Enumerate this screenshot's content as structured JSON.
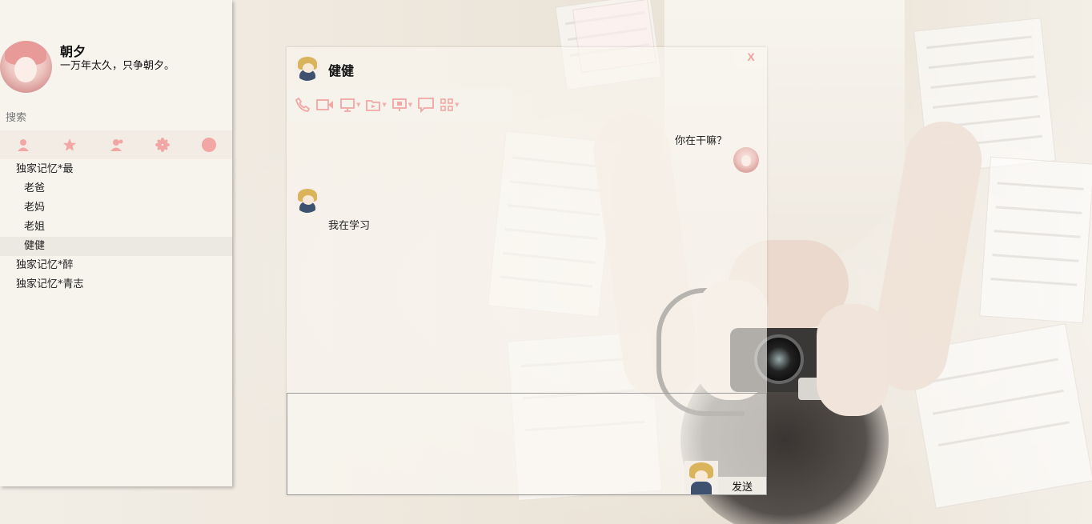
{
  "profile": {
    "nickname": "朝夕",
    "signature": "一万年太久，只争朝夕。"
  },
  "search": {
    "placeholder": "搜索"
  },
  "tabs": [
    {
      "icon": "person-icon"
    },
    {
      "icon": "star-icon"
    },
    {
      "icon": "group-icon"
    },
    {
      "icon": "flower-icon"
    },
    {
      "icon": "circle-icon"
    }
  ],
  "groups": [
    {
      "name": "独家记忆*最",
      "friends": [
        {
          "name": "老爸"
        },
        {
          "name": "老妈"
        },
        {
          "name": "老姐"
        },
        {
          "name": "健健"
        }
      ]
    },
    {
      "name": "独家记忆*醉",
      "friends": []
    },
    {
      "name": "独家记忆*青志",
      "friends": []
    }
  ],
  "chat": {
    "close_label": "X",
    "contact_name": "健健",
    "toolbar": [
      {
        "icon": "phone-icon"
      },
      {
        "icon": "video-icon"
      },
      {
        "icon": "screen-share-icon"
      },
      {
        "icon": "file-transfer-icon"
      },
      {
        "icon": "remote-desktop-icon"
      },
      {
        "icon": "message-icon"
      },
      {
        "icon": "apps-icon"
      }
    ],
    "messages": [
      {
        "from": "me",
        "text": "你在干嘛？"
      },
      {
        "from": "contact",
        "text": "我在学习"
      }
    ],
    "send_label": "发送"
  },
  "colors": {
    "accent": "#f0a8a8",
    "panel_bg": "#f7f4ee"
  }
}
